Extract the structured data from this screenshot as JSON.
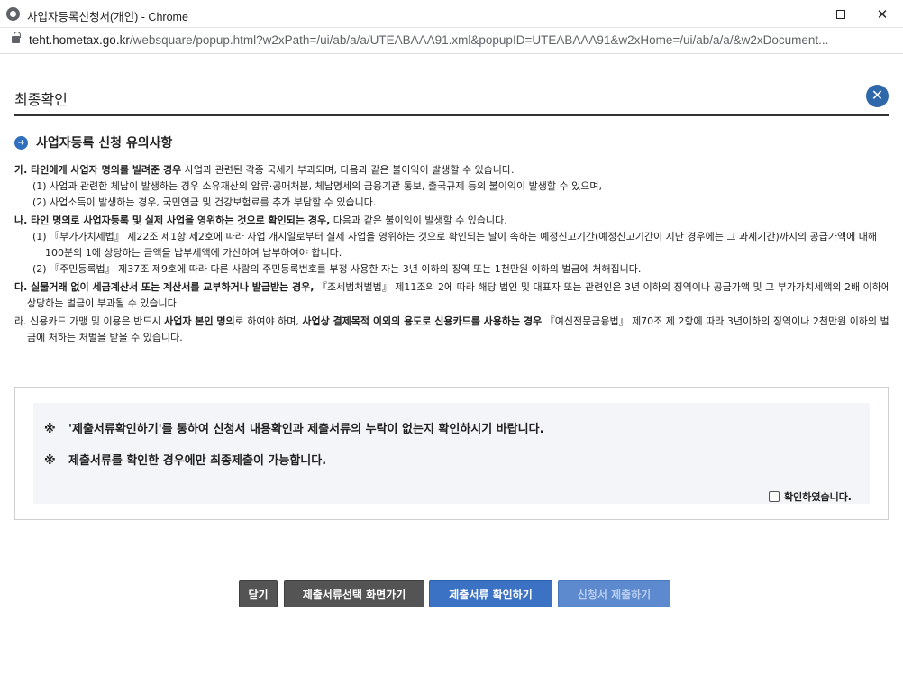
{
  "window": {
    "title": "사업자등록신청서(개인) - Chrome",
    "url_host": "teht.hometax.go.kr",
    "url_rest": "/websquare/popup.html?w2xPath=/ui/ab/a/a/UTEABAAA91.xml&popupID=UTEABAAA91&w2xHome=/ui/ab/a/a/&w2xDocument..."
  },
  "popup": {
    "title": "최종확인",
    "close_symbol": "✕"
  },
  "section": {
    "title": "사업자등록 신청 유의사항"
  },
  "notice": {
    "ga_bold": "가. 타인에게 사업자 명의를 빌려준 경우",
    "ga_text": " 사업과 관련된 각종 국세가 부과되며, 다음과 같은 불이익이 발생할 수 있습니다.",
    "ga_1": "(1) 사업과 관련한 체납이 발생하는 경우 소유재산의 압류·공매처분, 체납명세의 금융기관 통보, 출국규제 등의 불이익이 발생할 수 있으며,",
    "ga_2": "(2) 사업소득이 발생하는 경우, 국민연금 및 건강보험료를 추가 부담할 수 있습니다.",
    "na_bold": "나. 타인 명의로 사업자등록 및 실제 사업을 영위하는 것으로 확인되는 경우,",
    "na_text": " 다음과 같은 불이익이 발생할 수 있습니다.",
    "na_1": "(1) 『부가가치세법』 제22조 제1항 제2호에 따라 사업 개시일로부터 실제 사업을 영위하는 것으로 확인되는 날이 속하는 예정신고기간(예정신고기간이 지난 경우에는 그 과세기간)까지의 공급가액에 대해 100분의 1에 상당하는 금액을 납부세액에 가산하여 납부하여야 합니다.",
    "na_2": "(2) 『주민등록법』 제37조 제9호에 따라 다른 사람의 주민등록번호를 부정 사용한 자는 3년 이하의 징역 또는 1천만원 이하의 벌금에 처해집니다.",
    "da_bold": "다. 실물거래 없이 세금계산서 또는 계산서를 교부하거나 발급받는 경우,",
    "da_text": " 『조세범처벌법』 제11조의 2에 따라 해당 법인 및 대표자 또는 관련인은 3년 이하의 징역이나 공급가액 및 그 부가가치세액의 2배 이하에 상당하는 벌금이 부과될 수 있습니다.",
    "ra_pre": "라. 신용카드 가맹 및 이용은 반드시 ",
    "ra_bold1": "사업자 본인 명의",
    "ra_mid": "로 하여야 하며, ",
    "ra_bold2": "사업상 결제목적 이외의 용도로 신용카드를 사용하는 경우",
    "ra_text": " 『여신전문금융법』 제70조 제 2항에 따라 3년이하의 징역이나 2천만원 이하의 벌금에 처하는 처벌을 받을 수 있습니다."
  },
  "confirm": {
    "mark": "※",
    "line1": "'제출서류확인하기'를 통하여 신청서 내용확인과 제출서류의 누락이 없는지 확인하시기 바랍니다.",
    "line2": "제출서류를 확인한 경우에만 최종제출이 가능합니다.",
    "checkbox_label": "확인하였습니다.",
    "checked": false
  },
  "buttons": {
    "close": "닫기",
    "select_docs": "제출서류선택 화면가기",
    "check_docs": "제출서류 확인하기",
    "submit": "신청서 제출하기"
  }
}
